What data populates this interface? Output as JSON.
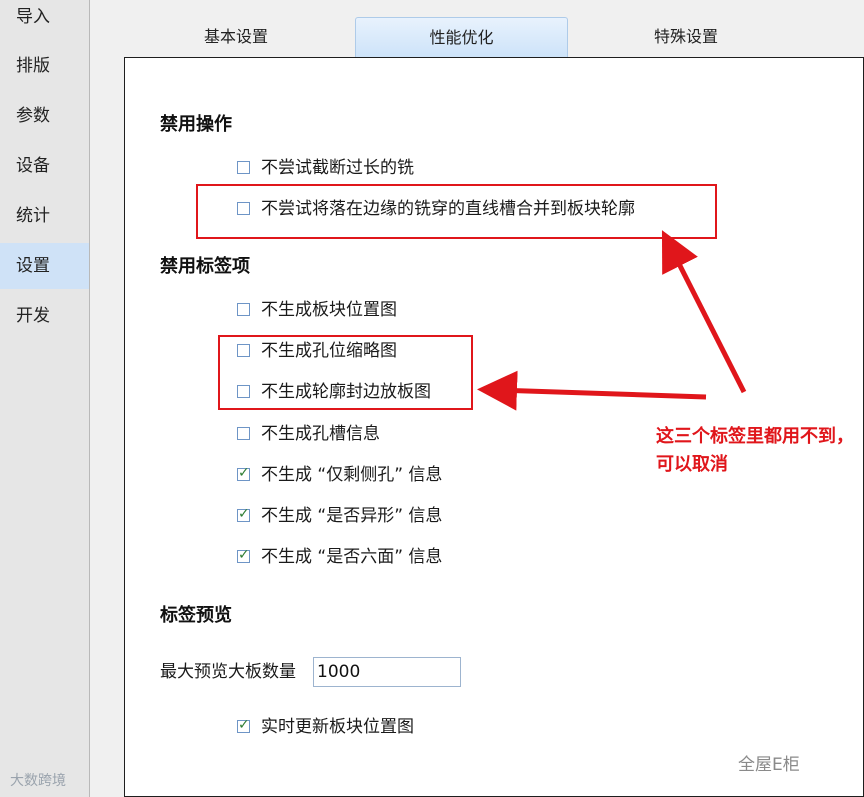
{
  "sidebar": {
    "items": [
      {
        "label": "导入"
      },
      {
        "label": "排版"
      },
      {
        "label": "参数"
      },
      {
        "label": "设备"
      },
      {
        "label": "统计"
      },
      {
        "label": "设置"
      },
      {
        "label": "开发"
      }
    ],
    "active_index": 5
  },
  "tabs": [
    {
      "label": "基本设置"
    },
    {
      "label": "性能优化"
    },
    {
      "label": "特殊设置"
    }
  ],
  "active_tab": 1,
  "sections": {
    "disable_ops": {
      "title": "禁用操作",
      "items": [
        {
          "label": "不尝试截断过长的铣",
          "checked": false
        },
        {
          "label": "不尝试将落在边缘的铣穿的直线槽合并到板块轮廓",
          "checked": false
        }
      ]
    },
    "disable_labels": {
      "title": "禁用标签项",
      "items": [
        {
          "label": "不生成板块位置图",
          "checked": false
        },
        {
          "label": "不生成孔位缩略图",
          "checked": false
        },
        {
          "label": "不生成轮廓封边放板图",
          "checked": false
        },
        {
          "label": "不生成孔槽信息",
          "checked": false
        },
        {
          "label": "不生成 “仅剩侧孔” 信息",
          "checked": true
        },
        {
          "label": "不生成 “是否异形” 信息",
          "checked": true
        },
        {
          "label": "不生成 “是否六面” 信息",
          "checked": true
        }
      ]
    },
    "label_preview": {
      "title": "标签预览",
      "max_boards_label": "最大预览大板数量",
      "max_boards_value": "1000",
      "realtime": {
        "label": "实时更新板块位置图",
        "checked": true
      }
    }
  },
  "annotation": {
    "text": "这三个标签里都用不到，可以取消",
    "color": "#e0161b"
  },
  "watermarks": {
    "left": "大数跨境",
    "right": "全屋E柜"
  },
  "colors": {
    "active_bg": "#cfe2f7",
    "check_color": "#2e7d32",
    "highlight_red": "#e0161b"
  }
}
